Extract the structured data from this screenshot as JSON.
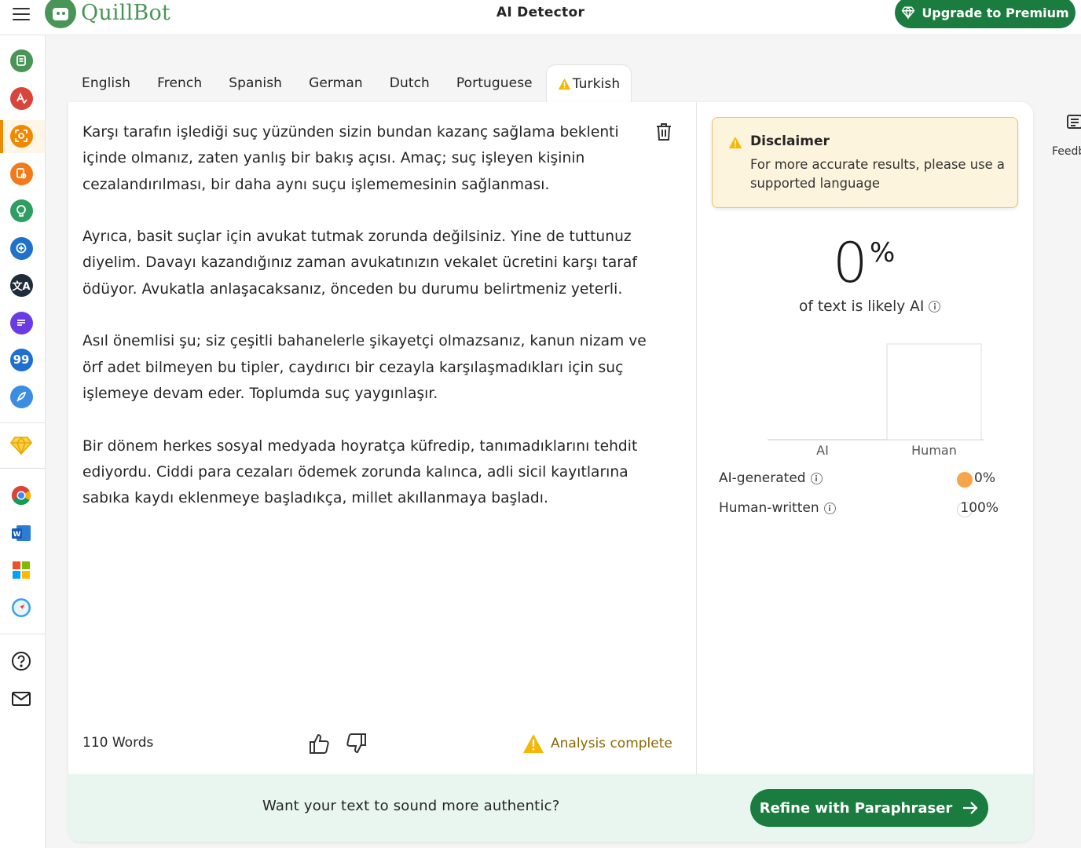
{
  "header": {
    "brand": "QuillBot",
    "title": "AI Detector",
    "upgrade_label": "Upgrade to Premium"
  },
  "sidebar": {
    "items": [
      {
        "name": "paraphraser",
        "color": "#499557"
      },
      {
        "name": "grammar-checker",
        "color": "#d9443b"
      },
      {
        "name": "ai-detector",
        "color": "#ee8a00"
      },
      {
        "name": "plagiarism-checker",
        "color": "#f27a1a"
      },
      {
        "name": "ai-humanizer",
        "color": "#2f9e62"
      },
      {
        "name": "ai-chat",
        "color": "#1f72c9"
      },
      {
        "name": "translator",
        "color": "#1f2a3a"
      },
      {
        "name": "summarizer",
        "color": "#6a3be0"
      },
      {
        "name": "citation-generator",
        "color": "#1f6fd0"
      },
      {
        "name": "ai-writing",
        "color": "#3a8de0"
      }
    ],
    "bottom_icons": [
      "premium-icon",
      "chrome-icon",
      "word-icon",
      "microsoft-icon",
      "safari-icon",
      "help-icon",
      "mail-icon"
    ]
  },
  "tabs": [
    {
      "label": "English"
    },
    {
      "label": "French"
    },
    {
      "label": "Spanish"
    },
    {
      "label": "German"
    },
    {
      "label": "Dutch"
    },
    {
      "label": "Portuguese"
    },
    {
      "label": "Turkish",
      "active": true
    }
  ],
  "editor": {
    "paragraphs": [
      "Karşı tarafın işlediği suç yüzünden sizin bundan kazanç sağlama beklenti içinde olmanız, zaten yanlış bir bakış açısı. Amaç; suç işleyen kişinin cezalandırılması, bir daha aynı suçu işlememesinin sağlanması.",
      "Ayrıca, basit suçlar için avukat tutmak zorunda değilsiniz. Yine de tuttunuz diyelim. Davayı kazandığınız zaman avukatınızın vekalet ücretini karşı taraf ödüyor. Avukatla anlaşacaksanız, önceden bu durumu belirtmeniz yeterli.",
      "Asıl önemlisi şu; siz çeşitli bahanelerle şikayetçi olmazsanız, kanun nizam ve örf adet bilmeyen bu tipler, caydırıcı bir cezayla karşılaşmadıkları için suç işlemeye devam eder. Toplumda suç yaygınlaşır.",
      "Bir dönem herkes sosyal medyada hoyratça küfredip, tanımadıklarını tehdit ediyordu. Ciddi para cezaları ödemek zorunda kalınca, adli sicil kayıtlarına sabıka kaydı eklenmeye başladıkça, millet akıllanmaya başladı."
    ],
    "word_count": "110 Words",
    "analysis_status": "Analysis complete"
  },
  "cta": {
    "prompt": "Want your text to sound more authentic?",
    "button_label": "Refine with Paraphraser"
  },
  "results": {
    "disclaimer_title": "Disclaimer",
    "disclaimer_body": "For more accurate results, please use a supported language",
    "score": "0",
    "score_unit": "%",
    "score_caption": "of text is likely AI",
    "legend": [
      {
        "label": "AI-generated",
        "value": "0%",
        "color": "#f7a548"
      },
      {
        "label": "Human-written",
        "value": "100%",
        "color": "#ffffff"
      }
    ]
  },
  "chart_data": {
    "type": "bar",
    "categories": [
      "AI",
      "Human"
    ],
    "values": [
      0,
      100
    ],
    "ylim": [
      0,
      100
    ],
    "colors": [
      "#f7a548",
      "#ffffff"
    ]
  },
  "feedback": {
    "label": "Feedback"
  }
}
